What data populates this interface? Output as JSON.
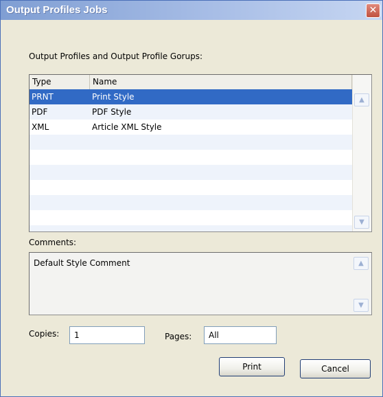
{
  "window": {
    "title": "Output Profiles Jobs",
    "close_icon": "close-icon"
  },
  "profiles": {
    "label": "Output Profiles and Output Profile Gorups:",
    "columns": [
      "Type",
      "Name"
    ],
    "rows": [
      {
        "type": "PRNT",
        "name": "Print Style",
        "selected": true
      },
      {
        "type": "PDF",
        "name": "PDF Style",
        "selected": false
      },
      {
        "type": "XML",
        "name": "Article XML Style",
        "selected": false
      }
    ],
    "empty_rows": 7,
    "selection_color": "#316ac5"
  },
  "comments": {
    "label": "Comments:",
    "value": "Default Style Comment"
  },
  "copies": {
    "label": "Copies:",
    "value": "1"
  },
  "pages": {
    "label": "Pages:",
    "value": "All"
  },
  "buttons": {
    "print": "Print",
    "cancel": "Cancel"
  },
  "icons": {
    "scroll_up": "chevron-up-icon",
    "scroll_down": "chevron-down-icon"
  }
}
